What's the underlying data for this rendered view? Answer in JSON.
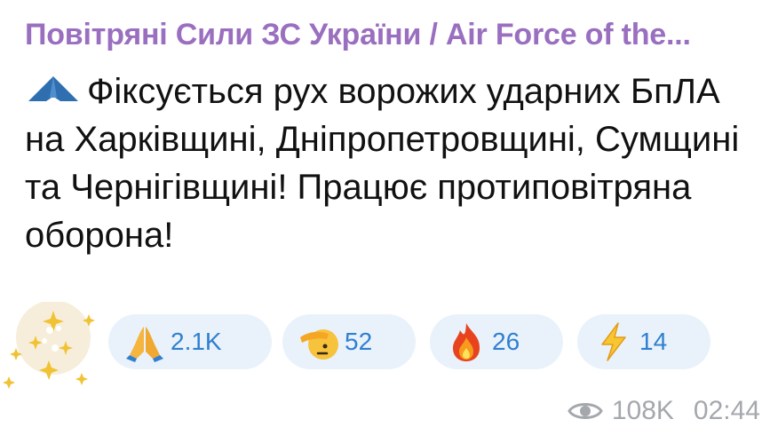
{
  "channel": {
    "name": "Повітряні Сили ЗС України / Air Force of the..."
  },
  "message": {
    "icon": "shahed-drone-icon",
    "text": "Фіксується рух ворожих ударних БпЛА на Харківщині, Дніпропетровщині, Сумщині та Чернігівщині! Працює протиповітряна оборона!"
  },
  "reactions": [
    {
      "emoji": "folded-hands",
      "count": "2.1K"
    },
    {
      "emoji": "saluting-face",
      "count": "52"
    },
    {
      "emoji": "fire",
      "count": "26"
    },
    {
      "emoji": "high-voltage",
      "count": "14"
    }
  ],
  "meta": {
    "views": "108K",
    "time": "02:44"
  },
  "colors": {
    "channel_name": "#9a6fc0",
    "reaction_bg": "#e9f2fb",
    "reaction_count": "#2f7fd1",
    "meta": "#a4a8ad"
  }
}
